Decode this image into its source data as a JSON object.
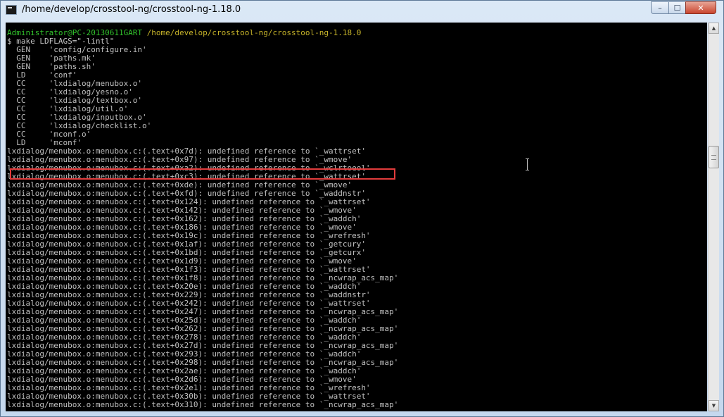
{
  "window": {
    "title": "/home/develop/crosstool-ng/crosstool-ng-1.18.0",
    "controls": {
      "minimize": "–",
      "maximize": "☐",
      "close": "✕"
    }
  },
  "terminal": {
    "prompt_user": "Administrator@PC-20130611GART",
    "prompt_path": "/home/develop/crosstool-ng/crosstool-ng-1.18.0",
    "lines": [
      "$ make LDFLAGS=\"-lintl\"",
      "  GEN    'config/configure.in'",
      "  GEN    'paths.mk'",
      "  GEN    'paths.sh'",
      "  LD     'conf'",
      "  CC     'lxdialog/menubox.o'",
      "  CC     'lxdialog/yesno.o'",
      "  CC     'lxdialog/textbox.o'",
      "  CC     'lxdialog/util.o'",
      "  CC     'lxdialog/inputbox.o'",
      "  CC     'lxdialog/checklist.o'",
      "  CC     'mconf.o'",
      "  LD     'mconf'",
      "lxdialog/menubox.o:menubox.c:(.text+0x7d): undefined reference to `_wattrset'",
      "lxdialog/menubox.o:menubox.c:(.text+0x97): undefined reference to `_wmove'",
      "lxdialog/menubox.o:menubox.c:(.text+0xa2): undefined reference to `_wclrtoeol'",
      "lxdialog/menubox.o:menubox.c:(.text+0xc3): undefined reference to `_wattrset'",
      "lxdialog/menubox.o:menubox.c:(.text+0xde): undefined reference to `_wmove'",
      "lxdialog/menubox.o:menubox.c:(.text+0xfd): undefined reference to `_waddnstr'",
      "lxdialog/menubox.o:menubox.c:(.text+0x124): undefined reference to `_wattrset'",
      "lxdialog/menubox.o:menubox.c:(.text+0x142): undefined reference to `_wmove'",
      "lxdialog/menubox.o:menubox.c:(.text+0x162): undefined reference to `_waddch'",
      "lxdialog/menubox.o:menubox.c:(.text+0x186): undefined reference to `_wmove'",
      "lxdialog/menubox.o:menubox.c:(.text+0x19c): undefined reference to `_wrefresh'",
      "lxdialog/menubox.o:menubox.c:(.text+0x1af): undefined reference to `_getcury'",
      "lxdialog/menubox.o:menubox.c:(.text+0x1bd): undefined reference to `_getcurx'",
      "lxdialog/menubox.o:menubox.c:(.text+0x1d9): undefined reference to `_wmove'",
      "lxdialog/menubox.o:menubox.c:(.text+0x1f3): undefined reference to `_wattrset'",
      "lxdialog/menubox.o:menubox.c:(.text+0x1f8): undefined reference to `_ncwrap_acs_map'",
      "lxdialog/menubox.o:menubox.c:(.text+0x20e): undefined reference to `_waddch'",
      "lxdialog/menubox.o:menubox.c:(.text+0x229): undefined reference to `_waddnstr'",
      "lxdialog/menubox.o:menubox.c:(.text+0x242): undefined reference to `_wattrset'",
      "lxdialog/menubox.o:menubox.c:(.text+0x247): undefined reference to `_ncwrap_acs_map'",
      "lxdialog/menubox.o:menubox.c:(.text+0x25d): undefined reference to `_waddch'",
      "lxdialog/menubox.o:menubox.c:(.text+0x262): undefined reference to `_ncwrap_acs_map'",
      "lxdialog/menubox.o:menubox.c:(.text+0x278): undefined reference to `_waddch'",
      "lxdialog/menubox.o:menubox.c:(.text+0x27d): undefined reference to `_ncwrap_acs_map'",
      "lxdialog/menubox.o:menubox.c:(.text+0x293): undefined reference to `_waddch'",
      "lxdialog/menubox.o:menubox.c:(.text+0x298): undefined reference to `_ncwrap_acs_map'",
      "lxdialog/menubox.o:menubox.c:(.text+0x2ae): undefined reference to `_waddch'",
      "lxdialog/menubox.o:menubox.c:(.text+0x2d6): undefined reference to `_wmove'",
      "lxdialog/menubox.o:menubox.c:(.text+0x2e1): undefined reference to `_wrefresh'",
      "lxdialog/menubox.o:menubox.c:(.text+0x30b): undefined reference to `_wattrset'",
      "lxdialog/menubox.o:menubox.c:(.text+0x310): undefined reference to `_ncwrap_acs_map'"
    ]
  },
  "colors": {
    "prompt_user": "#31c22b",
    "prompt_path": "#c7b42a",
    "text": "#c0c0c0",
    "highlight": "#e23c3c"
  },
  "icons": {
    "app": "console-icon",
    "cursor": "text-cursor-icon"
  }
}
